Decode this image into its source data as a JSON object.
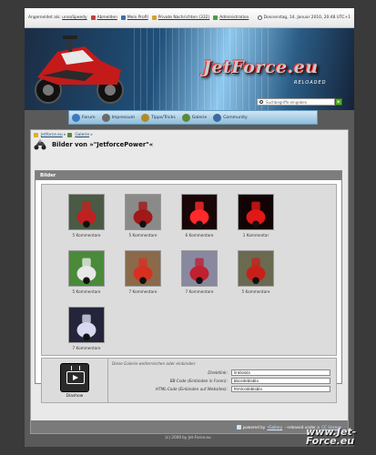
{
  "topbar": {
    "logged_in_prefix": "Angemeldet als:",
    "username": "unnoSpeedy",
    "links": [
      {
        "label": "Abmelden",
        "icon": "logout-icon",
        "color": "#c04040"
      },
      {
        "label": "Mein Profil",
        "icon": "profile-icon",
        "color": "#3a6ea5"
      },
      {
        "label": "Private Nachrichten (332)",
        "icon": "mail-icon",
        "color": "#d8a030"
      },
      {
        "label": "Administration",
        "icon": "admin-icon",
        "color": "#4a9a4a"
      }
    ],
    "datetime": "Donnerstag, 14. Januar 2010, 20:48 UTC+1"
  },
  "banner": {
    "logo": "JetForce.eu",
    "subtitle": "RELOADED",
    "search_placeholder": "Suchbegriffe eingeben",
    "search_go": "▸"
  },
  "nav": [
    {
      "label": "Forum",
      "icon": "forum-icon",
      "color": "#3b7bbd"
    },
    {
      "label": "Impressum",
      "icon": "info-icon",
      "color": "#6a6a6a"
    },
    {
      "label": "Tipps/Tricks",
      "icon": "tools-icon",
      "color": "#b08a2a"
    },
    {
      "label": "Galerie",
      "icon": "gallery-icon",
      "color": "#5a8a3a"
    },
    {
      "label": "Community",
      "icon": "community-icon",
      "color": "#3a6aa0"
    }
  ],
  "breadcrumb": {
    "home": "Jetforce.eu",
    "sep": "»",
    "current": "Galerie",
    "sep2": "»"
  },
  "page_title": "Bilder von »\"JetforcePower\"«",
  "gallery": {
    "header": "Bilder",
    "items": [
      {
        "caption": "5 Kommentare",
        "bg": "#4a5a44",
        "fg": "#c02020"
      },
      {
        "caption": "5 Kommentare",
        "bg": "#8a8a88",
        "fg": "#a01818"
      },
      {
        "caption": "6 Kommentare",
        "bg": "#1a0606",
        "fg": "#ff2a2a"
      },
      {
        "caption": "1 Kommentar",
        "bg": "#120404",
        "fg": "#e01818"
      },
      {
        "caption": "5 Kommentare",
        "bg": "#4a8a3a",
        "fg": "#e8e8e8"
      },
      {
        "caption": "7 Kommentare",
        "bg": "#8a6a4a",
        "fg": "#d83020"
      },
      {
        "caption": "7 Kommentare",
        "bg": "#8888a0",
        "fg": "#c02030"
      },
      {
        "caption": "5 Kommentare",
        "bg": "#6a6a50",
        "fg": "#c82018"
      },
      {
        "caption": "7 Kommentare",
        "bg": "#24243a",
        "fg": "#d8d8f0"
      }
    ]
  },
  "slideshow": {
    "label": "Diashow"
  },
  "embed": {
    "intro": "Diese Galerie weiterreichen oder einbinden:",
    "rows": [
      {
        "label": "Direktlink:",
        "value": "linklolola"
      },
      {
        "label": "BB-Code (Einbinden in Foren):",
        "value": "bbcodeblabla"
      },
      {
        "label": "HTML-Code (Einbinden auf Websites):",
        "value": "htmlcodeblabla"
      }
    ]
  },
  "footer": {
    "powered_prefix": "powered by",
    "gallery_link": "rGallery",
    "released": "- released under a",
    "license_link": "CC license",
    "copyright": "(c) 2009 by Jet-Force.eu"
  },
  "watermark": "www.Jet-Force.eu"
}
